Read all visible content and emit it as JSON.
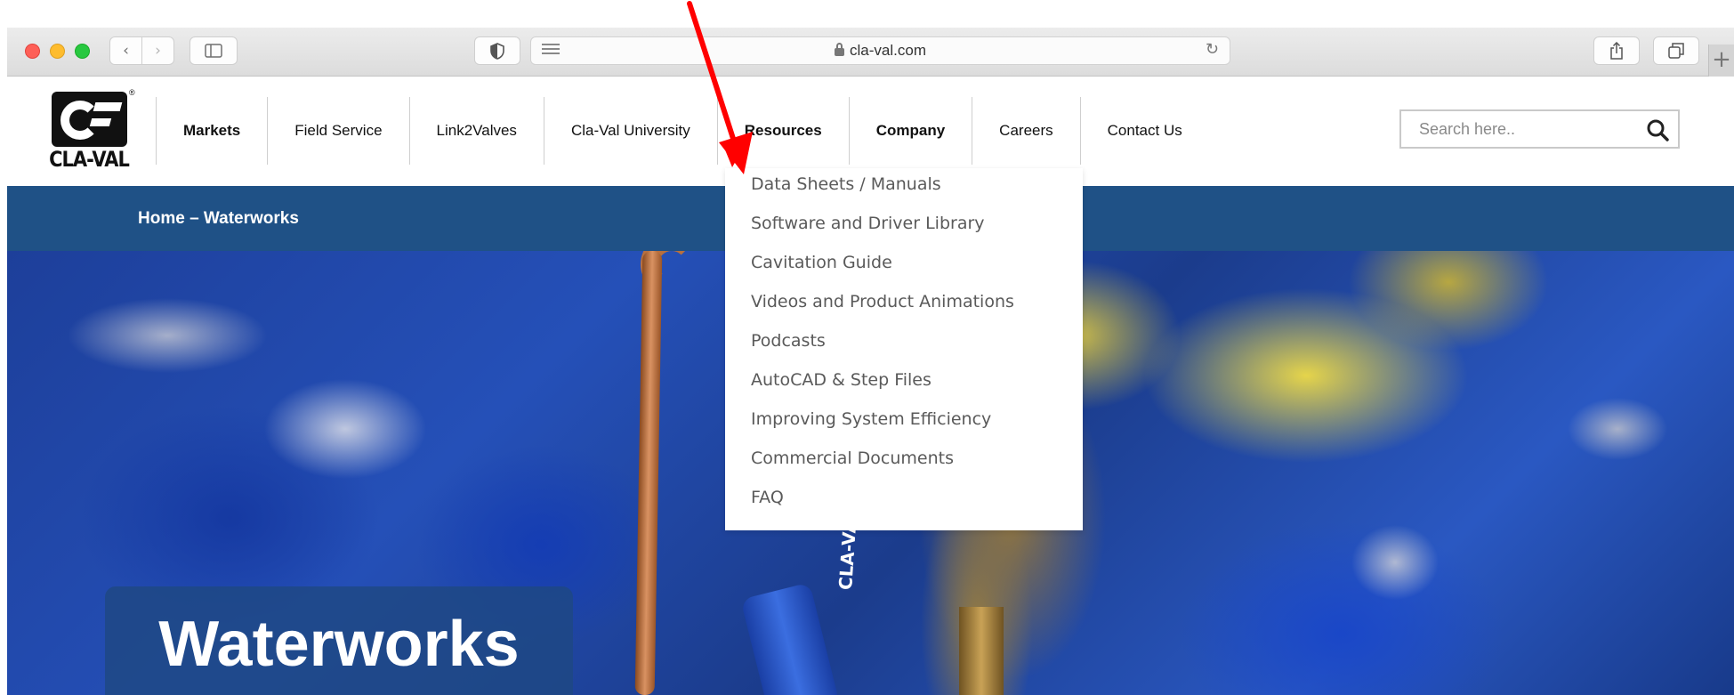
{
  "browser": {
    "url": "cla-val.com",
    "icons": [
      "close-window",
      "minimize-window",
      "maximize-window",
      "chevron-left",
      "chevron-right",
      "sidebar",
      "shield",
      "reader",
      "lock",
      "reload",
      "share",
      "tabs",
      "plus"
    ],
    "new_tab_glyph": "+"
  },
  "site": {
    "logo_text": "CLA-VAL",
    "nav": [
      {
        "label": "Markets"
      },
      {
        "label": "Field Service"
      },
      {
        "label": "Link2Valves"
      },
      {
        "label": "Cla-Val University"
      },
      {
        "label": "Resources"
      },
      {
        "label": "Company"
      },
      {
        "label": "Careers"
      },
      {
        "label": "Contact Us"
      }
    ],
    "search": {
      "placeholder": "Search here.."
    }
  },
  "dropdown": {
    "parent": "Resources",
    "items": [
      {
        "label": "Data Sheets / Manuals"
      },
      {
        "label": "Software and Driver Library"
      },
      {
        "label": "Cavitation Guide"
      },
      {
        "label": "Videos and Product Animations"
      },
      {
        "label": "Podcasts"
      },
      {
        "label": "AutoCAD & Step Files"
      },
      {
        "label": "Improving System Efficiency"
      },
      {
        "label": "Commercial Documents"
      },
      {
        "label": "FAQ"
      }
    ]
  },
  "breadcrumb": "Home – Waterworks",
  "hero": {
    "title": "Waterworks",
    "handle_text": "CLA-VAL"
  },
  "colors": {
    "header_band": "#1f5186",
    "annotation_arrow": "#ff0000",
    "dropdown_text": "#5a5a5a"
  }
}
